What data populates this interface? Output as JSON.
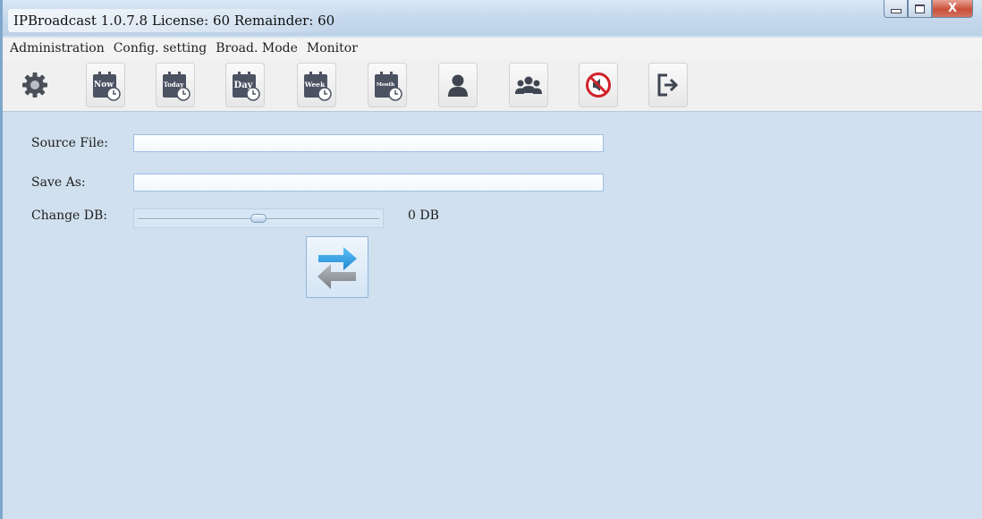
{
  "window": {
    "title": "IPBroadcast 1.0.7.8 License: 60 Remainder: 60",
    "controls": {
      "minimize_icon": "minimize-icon",
      "maximize_icon": "maximize-icon",
      "close_label": "X"
    }
  },
  "menu": {
    "items": [
      {
        "label": "Administration"
      },
      {
        "label": "Config. setting"
      },
      {
        "label": "Broad. Mode"
      },
      {
        "label": "Monitor"
      }
    ]
  },
  "toolbar": {
    "buttons": [
      {
        "icon": "gear-icon"
      },
      {
        "icon": "calendar-now-icon",
        "label": "Now"
      },
      {
        "icon": "calendar-today-icon",
        "label": "Today"
      },
      {
        "icon": "calendar-day-icon",
        "label": "Day"
      },
      {
        "icon": "calendar-week-icon",
        "label": "Week"
      },
      {
        "icon": "calendar-month-icon",
        "label": "Month"
      },
      {
        "icon": "user-icon"
      },
      {
        "icon": "user-group-icon"
      },
      {
        "icon": "mute-icon"
      },
      {
        "icon": "exit-icon"
      }
    ]
  },
  "form": {
    "source_file": {
      "label": "Source File:",
      "value": ""
    },
    "save_as": {
      "label": "Save As:",
      "value": ""
    },
    "change_db": {
      "label": "Change DB:",
      "value_text": "0 DB",
      "slider_position": 0.5
    },
    "convert_button_icon": "convert-arrows-icon"
  },
  "colors": {
    "accent": "#2b8fd6",
    "content_bg": "#d0e0ef",
    "close": "#c9503a"
  }
}
